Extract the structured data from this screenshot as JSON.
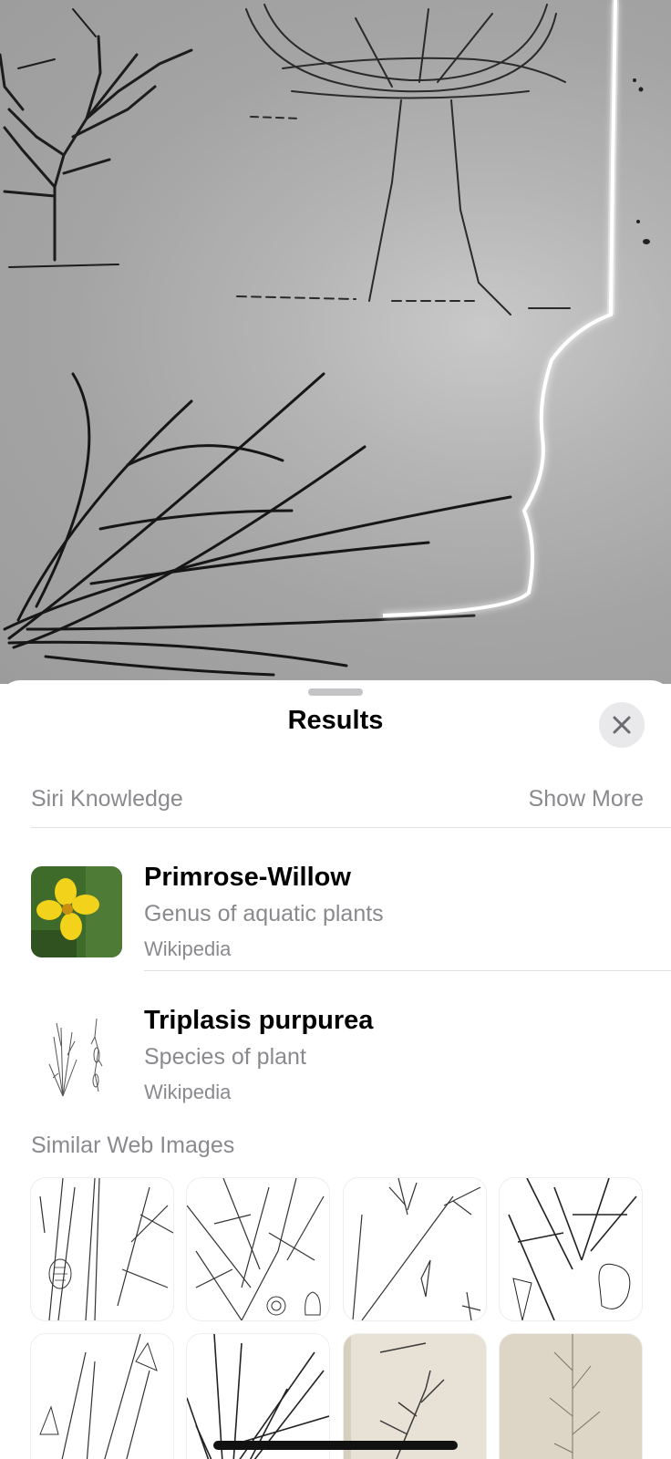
{
  "sheet": {
    "title": "Results",
    "close_icon": "close-icon"
  },
  "siri_knowledge": {
    "header": "Siri Knowledge",
    "show_more": "Show More",
    "results": [
      {
        "name": "Primrose-Willow",
        "description": "Genus of aquatic plants",
        "source": "Wikipedia",
        "thumb_icon": "yellow-flower-photo"
      },
      {
        "name": "Triplasis purpurea",
        "description": "Species of plant",
        "source": "Wikipedia",
        "thumb_icon": "botanical-illustration"
      }
    ]
  },
  "similar_images": {
    "header": "Similar Web Images",
    "count_visible": 8
  },
  "colors": {
    "secondary_text": "#8a8a8e",
    "flower_yellow": "#f2d21b",
    "leaf_green": "#3f6b2a"
  }
}
